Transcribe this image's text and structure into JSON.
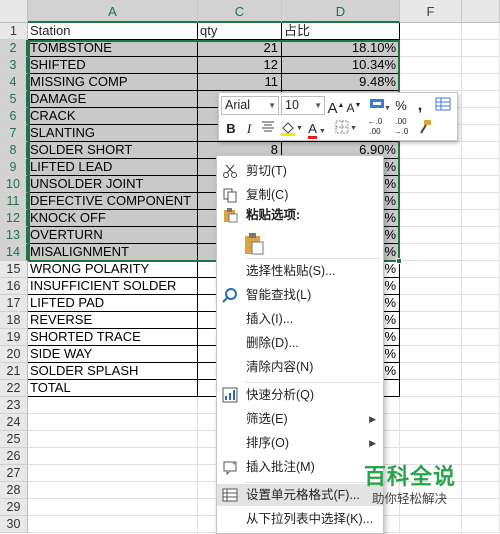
{
  "columns": [
    "A",
    "C",
    "D",
    "F"
  ],
  "row_numbers": [
    "1",
    "2",
    "3",
    "4",
    "5",
    "6",
    "7",
    "8",
    "9",
    "10",
    "11",
    "12",
    "13",
    "14",
    "15",
    "16",
    "17",
    "18",
    "19",
    "20",
    "21",
    "22",
    "23",
    "24",
    "25",
    "26",
    "27",
    "28",
    "29",
    "30"
  ],
  "header_row": {
    "station": "Station",
    "qty": "qty",
    "ratio": "占比"
  },
  "rows": [
    {
      "station": "TOMBSTONE",
      "qty": "21",
      "ratio": "18.10%"
    },
    {
      "station": "SHIFTED",
      "qty": "12",
      "ratio": "10.34%"
    },
    {
      "station": "MISSING COMP",
      "qty": "11",
      "ratio": "9.48%"
    },
    {
      "station": "DAMAGE",
      "qty": "",
      "ratio": ""
    },
    {
      "station": "CRACK",
      "qty": "",
      "ratio": ""
    },
    {
      "station": "SLANTING",
      "qty": "",
      "ratio": ""
    },
    {
      "station": "SOLDER SHORT",
      "qty": "8",
      "ratio": "6.90%"
    },
    {
      "station": "LIFTED LEAD",
      "qty": "",
      "ratio": "%"
    },
    {
      "station": "UNSOLDER JOINT",
      "qty": "",
      "ratio": "%"
    },
    {
      "station": "DEFECTIVE COMPONENT",
      "qty": "",
      "ratio": "%"
    },
    {
      "station": "KNOCK OFF",
      "qty": "",
      "ratio": "%"
    },
    {
      "station": "OVERTURN",
      "qty": "",
      "ratio": "%"
    },
    {
      "station": "MISALIGNMENT",
      "qty": "",
      "ratio": "%"
    },
    {
      "station": "WRONG POLARITY",
      "qty": "",
      "ratio": "%"
    },
    {
      "station": "INSUFFICIENT SOLDER",
      "qty": "",
      "ratio": "%"
    },
    {
      "station": "LIFTED PAD",
      "qty": "",
      "ratio": "%"
    },
    {
      "station": "REVERSE",
      "qty": "",
      "ratio": "%"
    },
    {
      "station": "SHORTED TRACE",
      "qty": "",
      "ratio": "%"
    },
    {
      "station": "SIDE WAY",
      "qty": "",
      "ratio": "%"
    },
    {
      "station": "SOLDER SPLASH",
      "qty": "",
      "ratio": "%"
    },
    {
      "station": "TOTAL",
      "qty": "",
      "ratio": ""
    }
  ],
  "mini_toolbar": {
    "font_name": "Arial",
    "font_size": "10",
    "increase_font": "A",
    "decrease_font": "A",
    "percent": "%",
    "comma": ",",
    "bold": "B",
    "italic": "I",
    "font_color_letter": "A",
    "inc_decimal": "←.0 .00",
    "dec_decimal": ".00 →.0"
  },
  "context_menu": [
    {
      "icon": "scissors-icon",
      "label": "剪切(T)"
    },
    {
      "icon": "copy-icon",
      "label": "复制(C)"
    },
    {
      "icon": "clipboard-icon",
      "label": "粘贴选项:"
    },
    {
      "icon": "paste-icon",
      "label": ""
    },
    {
      "icon": "",
      "label": "选择性粘贴(S)..."
    },
    {
      "icon": "search-icon",
      "label": "智能查找(L)"
    },
    {
      "icon": "",
      "label": "插入(I)..."
    },
    {
      "icon": "",
      "label": "删除(D)..."
    },
    {
      "icon": "",
      "label": "清除内容(N)"
    },
    {
      "icon": "quick-analysis-icon",
      "label": "快速分析(Q)"
    },
    {
      "icon": "",
      "label": "筛选(E)"
    },
    {
      "icon": "",
      "label": "排序(O)"
    },
    {
      "icon": "comment-icon",
      "label": "插入批注(M)"
    },
    {
      "icon": "format-cells-icon",
      "label": "设置单元格格式(F)..."
    },
    {
      "icon": "",
      "label": "从下拉列表中选择(K)..."
    }
  ],
  "watermark": {
    "title": "百科全说",
    "subtitle": "助你轻松解决"
  },
  "colors": {
    "accent": "#217346",
    "selection": "#c9c9c9",
    "watermark": "#2aa44a",
    "font_color": "#e02020",
    "highlight": "#ffe600"
  }
}
